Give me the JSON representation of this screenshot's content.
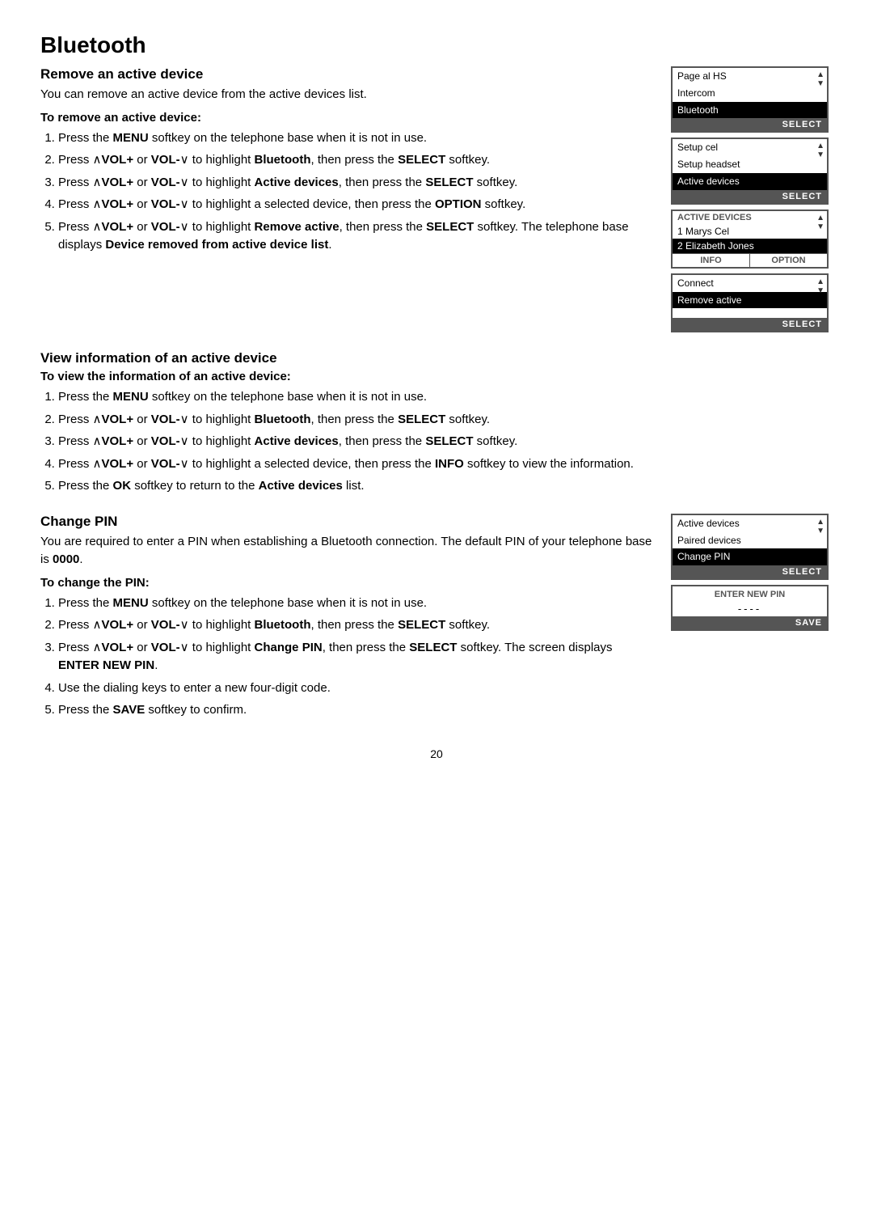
{
  "page": {
    "title": "Bluetooth",
    "page_number": "20"
  },
  "section1": {
    "heading": "Remove an active device",
    "intro": "You can remove an active device from the active devices list.",
    "sub_heading": "To remove an active device:",
    "steps": [
      "Press the MENU softkey on the telephone base when it is not in use.",
      "Press ∧VOL+ or VOL-∨ to highlight Bluetooth, then press the SELECT softkey.",
      "Press ∧VOL+ or VOL-∨ to highlight Active devices, then press the SELECT softkey.",
      "Press ∧VOL+ or VOL-∨ to highlight a selected device, then press the OPTION softkey.",
      "Press ∧VOL+ or VOL-∨ to highlight Remove active, then press the SELECT softkey. The telephone base displays Device removed from active device list."
    ]
  },
  "section2": {
    "heading": "View information of an active device",
    "sub_heading": "To view the information of an active device:",
    "steps": [
      "Press the MENU softkey on the telephone base when it is not in use.",
      "Press ∧VOL+ or VOL-∨ to highlight Bluetooth, then press the SELECT softkey.",
      "Press ∧VOL+ or VOL-∨ to highlight Active devices, then press the SELECT softkey.",
      "Press ∧VOL+ or VOL-∨ to highlight a selected device, then press the INFO softkey to view the information.",
      "Press the OK softkey to return to the Active devices list."
    ]
  },
  "section3": {
    "heading": "Change PIN",
    "intro_1": "You are required to enter a PIN when establishing a Bluetooth connection. The default PIN of your telephone base is",
    "default_pin": "0000",
    "intro_2": ".",
    "sub_heading": "To change the PIN:",
    "steps": [
      "Press the MENU softkey on the telephone base when it is not in use.",
      "Press ∧VOL+ or VOL-∨ to highlight Bluetooth, then press the SELECT softkey.",
      "Press ∧VOL+ or VOL-∨ to highlight Change PIN, then press the SELECT softkey. The screen displays ENTER NEW PIN.",
      "Use the dialing keys to enter a new four-digit code.",
      "Press the SAVE softkey to confirm."
    ]
  },
  "screens": {
    "screen1": {
      "items": [
        "Page al HS",
        "Intercom",
        "Bluetooth"
      ],
      "highlighted": "Bluetooth",
      "button": "SELECT"
    },
    "screen2": {
      "items": [
        "Setup cel",
        "Setup headset",
        "Active devices"
      ],
      "highlighted": "Active devices",
      "button": "SELECT"
    },
    "screen3": {
      "header": "ACTIVE DEVICES",
      "devices": [
        "1 Marys Cel",
        "2 Elizabeth Jones"
      ],
      "highlighted": "2 Elizabeth Jones",
      "buttons": [
        "INFO",
        "OPTION"
      ]
    },
    "screen4": {
      "items": [
        "Connect",
        "Remove active"
      ],
      "highlighted": "Remove active",
      "button": "SELECT"
    },
    "screen5": {
      "items": [
        "Active devices",
        "Paired devices",
        "Change PIN"
      ],
      "highlighted": "Change PIN",
      "button": "SELECT"
    },
    "screen6": {
      "label": "ENTER NEW PIN",
      "value": "----",
      "button": "SAVE"
    }
  }
}
